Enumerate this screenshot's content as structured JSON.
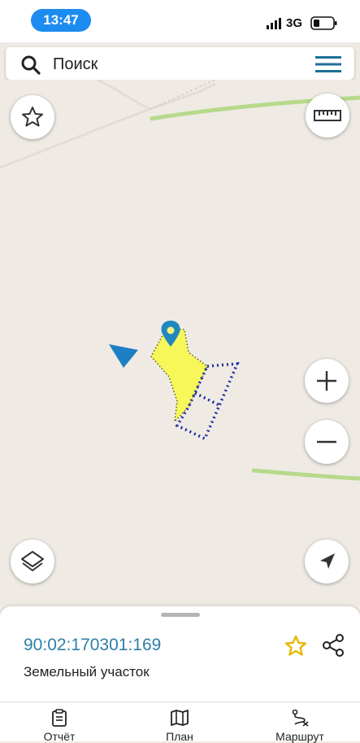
{
  "status_bar": {
    "time": "13:47",
    "network": "3G"
  },
  "search": {
    "placeholder": "Поиск",
    "icon": "search-icon",
    "menu_icon": "hamburger-menu-icon"
  },
  "map": {
    "favorites_icon": "star-outline-icon",
    "ruler_icon": "ruler-icon",
    "zoom_in_icon": "plus-icon",
    "zoom_out_icon": "minus-icon",
    "layers_icon": "layers-icon",
    "locate_icon": "navigation-arrow-icon",
    "parcel_fill_color": "#f7f75a",
    "parcel_outline_color": "#1f2ba3",
    "road_color": "#b7d98b",
    "marker_color": "#1f88c0"
  },
  "card": {
    "parcel_id": "90:02:170301:169",
    "parcel_type": "Земельный участок",
    "star_color": "#e6b800"
  },
  "bottom_nav": {
    "items": [
      {
        "label": "Отчёт",
        "icon": "clipboard-icon"
      },
      {
        "label": "План",
        "icon": "map-icon"
      },
      {
        "label": "Маршрут",
        "icon": "route-icon"
      }
    ]
  }
}
